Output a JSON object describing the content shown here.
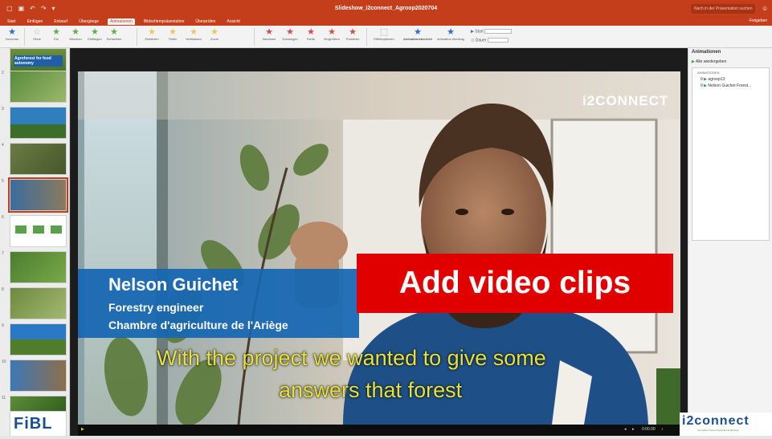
{
  "colors": {
    "accent": "#c43e1c",
    "banner": "#e00000",
    "lowerthird": "#1566b3",
    "caption": "#e8e23a"
  },
  "window": {
    "title": "Slideshow_i2connect_Agroop2020704",
    "search_placeholder": "Nach in der Präsentation suchen",
    "quick_icons": [
      "▢",
      "▣",
      "↶",
      "↷",
      "▾"
    ],
    "face_icon": "☺"
  },
  "tabs": [
    {
      "label": "Start",
      "active": false
    },
    {
      "label": "Einfügen",
      "active": false
    },
    {
      "label": "Entwurf",
      "active": false
    },
    {
      "label": "Übergänge",
      "active": false
    },
    {
      "label": "Animationen",
      "active": true
    },
    {
      "label": "Bildschirmpräsentation",
      "active": false
    },
    {
      "label": "Überprüfen",
      "active": false
    },
    {
      "label": "Ansicht",
      "active": false
    }
  ],
  "share_label": "Freigeben",
  "ribbon": {
    "preview": "Vorschau",
    "group1": [
      "Ohne",
      "Ein",
      "Wischen",
      "Einfliegen",
      "Schweben"
    ],
    "group2": [
      "Einfahren",
      "Teilen",
      "Verblassen",
      "Zoom"
    ],
    "group3": [
      "Wachsen",
      "Schwingen",
      "Farbe",
      "Vergrößern",
      "Pulsieren"
    ],
    "group4": [
      "Effektoptionen",
      "Animationsbereich",
      "Animation übertragen"
    ],
    "start_label": "Start",
    "duration_label": "Dauer"
  },
  "slides": {
    "numbers": [
      "1",
      "2",
      "3",
      "4",
      "5",
      "6",
      "7",
      "8",
      "9",
      "10",
      "11",
      "12"
    ],
    "first_title": "Agroforest for food autonomy",
    "logo": "FiBL"
  },
  "video": {
    "watermark": "i2CONNECT",
    "name": "Nelson Guichet",
    "role": "Forestry engineer",
    "org": "Chambre d'agriculture de l'Ariège",
    "caption_line1": "With the project we wanted to give some",
    "caption_line2": "answers that forest",
    "banner": "Add video clips"
  },
  "player": {
    "time": "0:00.00",
    "icons": [
      "◂",
      "▸",
      "♪",
      "⤢"
    ]
  },
  "animations": {
    "header": "Animationen",
    "play_label": "Alle wiedergeben",
    "list_title": "ANIMATIONEN",
    "items": [
      {
        "n": "0",
        "label": "agroop13"
      },
      {
        "n": "0",
        "label": "Nelson Guichet Forest..."
      }
    ]
  },
  "footer_logo": {
    "brand": "i2connect",
    "tagline": "Innovation beyond agricultural advisory"
  }
}
